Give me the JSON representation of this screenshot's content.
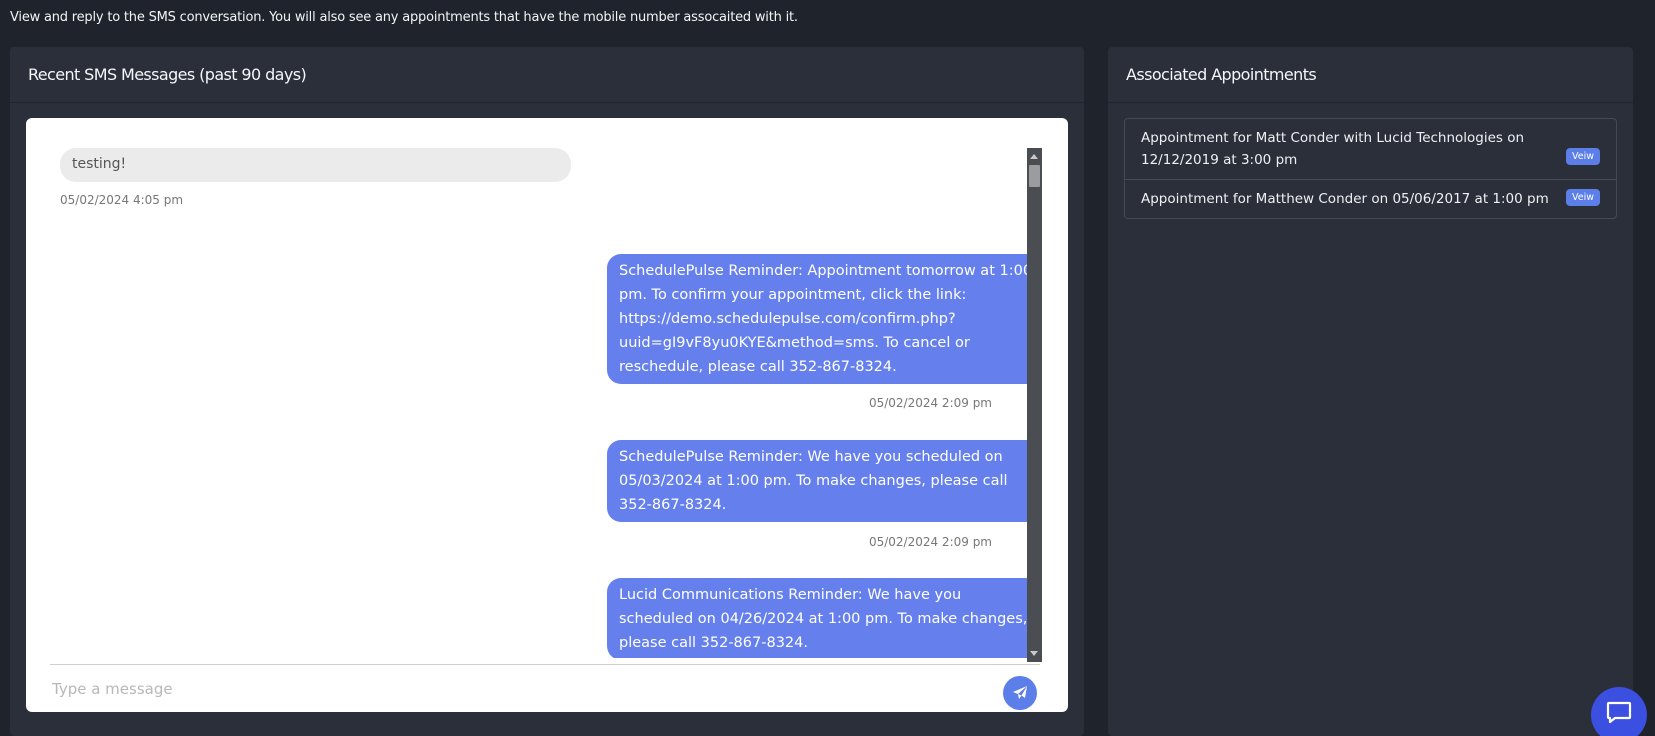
{
  "intro_text": "View and reply to the SMS conversation. You will also see any appointments that have the mobile number assocaited with it.",
  "sms_panel": {
    "title": "Recent SMS Messages (past 90 days)",
    "messages": [
      {
        "direction": "incoming",
        "text": "testing!",
        "timestamp": "05/02/2024 4:05 pm"
      },
      {
        "direction": "outgoing",
        "text": "SchedulePulse Reminder: Appointment tomorrow at 1:00 pm. To confirm your appointment, click the link: https://demo.schedulepulse.com/confirm.php?uuid=gI9vF8yu0KYE&method=sms. To cancel or reschedule, please call 352-867-8324.",
        "timestamp": "05/02/2024 2:09 pm"
      },
      {
        "direction": "outgoing",
        "text": "SchedulePulse Reminder: We have you scheduled on 05/03/2024 at 1:00 pm. To make changes, please call 352-867-8324.",
        "timestamp": "05/02/2024 2:09 pm"
      },
      {
        "direction": "outgoing",
        "text": "Lucid Communications Reminder: We have you scheduled on 04/26/2024 at 1:00 pm. To make changes, please call 352-867-8324.",
        "timestamp": ""
      }
    ],
    "compose_placeholder": "Type a message",
    "send_icon": "paper-plane-icon"
  },
  "appointments_panel": {
    "title": "Associated Appointments",
    "items": [
      {
        "text": "Appointment for Matt Conder with Lucid Technologies on 12/12/2019 at 3:00 pm",
        "badge": "Veiw"
      },
      {
        "text": "Appointment for Matthew Conder on 05/06/2017 at 1:00 pm",
        "badge": "Veiw"
      }
    ]
  },
  "help_button_icon": "chat-bubble-icon",
  "colors": {
    "page_bg": "#1f232b",
    "card_bg": "#2a2f39",
    "outgoing_bubble": "#6580ec",
    "incoming_bubble": "#ebebeb",
    "accent": "#5b7ee8"
  }
}
